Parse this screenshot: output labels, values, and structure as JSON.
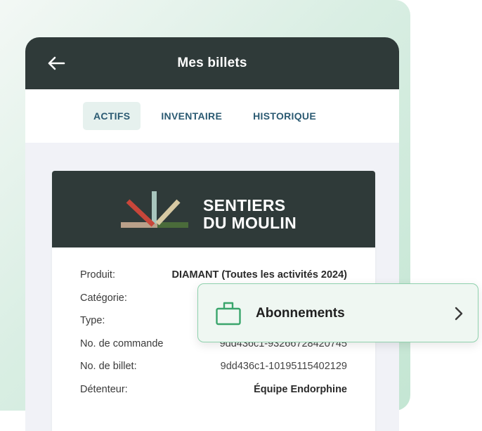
{
  "appbar": {
    "title": "Mes billets",
    "back_icon": "arrow-left-icon"
  },
  "tabs": [
    {
      "label": "ACTIFS",
      "active": true
    },
    {
      "label": "INVENTAIRE",
      "active": false
    },
    {
      "label": "HISTORIQUE",
      "active": false
    }
  ],
  "ticket": {
    "brand": {
      "line1": "SENTIERS",
      "line2": "DU MOULIN",
      "logo_icon": "sentiers-du-moulin-logo"
    },
    "details": [
      {
        "label": "Produit:",
        "value": "DIAMANT (Toutes les activités 2024)",
        "bold": true
      },
      {
        "label": "Catégorie:",
        "value": "",
        "bold": false
      },
      {
        "label": "Type:",
        "value": "",
        "bold": false
      },
      {
        "label": "No. de commande",
        "value": "9dd436c1-93266728420745",
        "bold": false
      },
      {
        "label": "No. de billet:",
        "value": "9dd436c1-10195115402129",
        "bold": false
      },
      {
        "label": "Détenteur:",
        "value": "Équipe Endorphine",
        "bold": true
      }
    ]
  },
  "popup": {
    "label": "Abonnements",
    "icon": "subscription-tag-icon",
    "chevron": "chevron-right-icon"
  },
  "colors": {
    "dark": "#2f3a39",
    "tab_text": "#2b5a72",
    "accent_green": "#8fd1ad",
    "logo_red": "#c8463a",
    "logo_sage": "#a8c5bd",
    "logo_beige": "#d7c9a3",
    "logo_tan": "#b9a08a",
    "logo_green": "#4a6b3a"
  }
}
